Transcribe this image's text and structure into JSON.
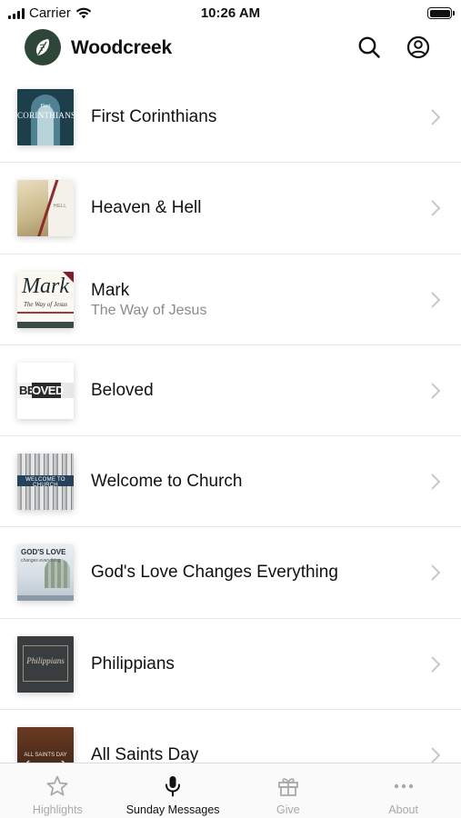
{
  "status_bar": {
    "carrier": "Carrier",
    "time": "10:26 AM"
  },
  "header": {
    "app_name": "Woodcreek",
    "logo_icon": "leaf-icon",
    "actions": [
      "search-icon",
      "account-icon"
    ]
  },
  "series": [
    {
      "title": "First Corinthians",
      "subtitle": "",
      "thumb": {
        "line1": "First",
        "line2": "CORINTHIANS"
      }
    },
    {
      "title": "Heaven & Hell",
      "subtitle": "",
      "thumb": {
        "text": "HELL"
      }
    },
    {
      "title": "Mark",
      "subtitle": "The Way of Jesus",
      "thumb": {
        "title": "Mark",
        "sub": "The Way of Jesus"
      }
    },
    {
      "title": "Beloved",
      "subtitle": "",
      "thumb": {
        "left": "BEL",
        "mid": "OVED"
      }
    },
    {
      "title": "Welcome to Church",
      "subtitle": "",
      "thumb": {
        "text": "WELCOME TO CHURCH"
      }
    },
    {
      "title": "God's Love Changes Everything",
      "subtitle": "",
      "thumb": {
        "line1": "GOD'S LOVE",
        "line2": "changes everything"
      }
    },
    {
      "title": "Philippians",
      "subtitle": "",
      "thumb": {
        "text": "Philippians"
      }
    },
    {
      "title": "All Saints Day",
      "subtitle": "",
      "thumb": {
        "text": "ALL SAINTS DAY"
      }
    }
  ],
  "tabs": [
    {
      "label": "Highlights",
      "icon": "star-icon",
      "active": false
    },
    {
      "label": "Sunday Messages",
      "icon": "microphone-icon",
      "active": true
    },
    {
      "label": "Give",
      "icon": "gift-icon",
      "active": false
    },
    {
      "label": "About",
      "icon": "more-icon",
      "active": false
    }
  ],
  "colors": {
    "text_primary": "#111111",
    "text_secondary": "#8a8a8a",
    "tab_inactive": "#a9a9a9",
    "logo_bg": "#2d4637"
  }
}
